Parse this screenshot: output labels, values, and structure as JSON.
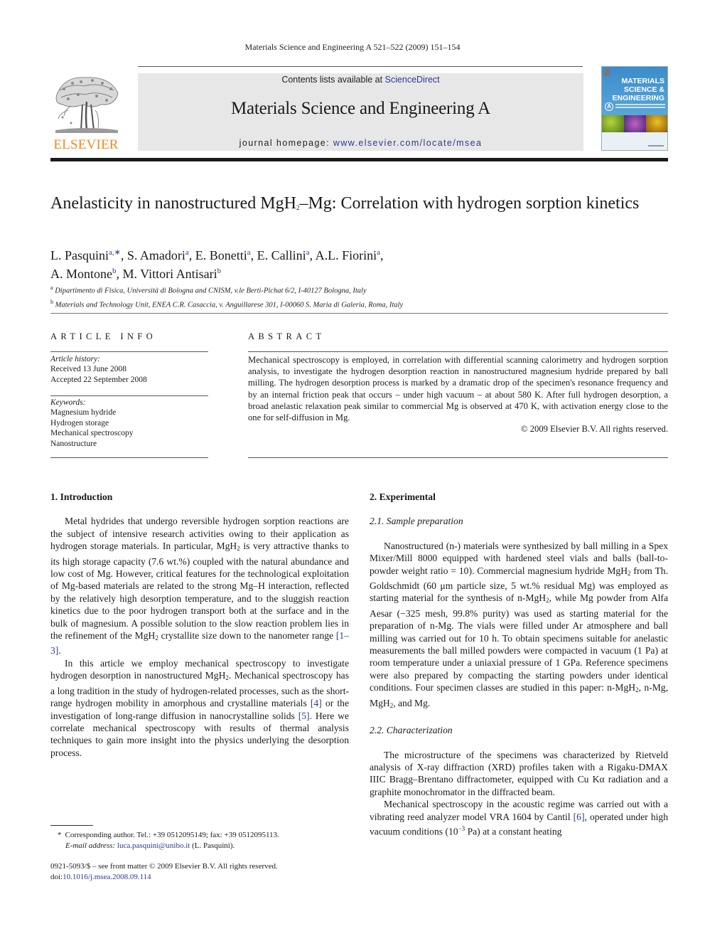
{
  "running_head": "Materials Science and Engineering A 521–522 (2009) 151–154",
  "publisher": {
    "logo_word": "ELSEVIER",
    "logo_icon": "elsevier-tree-icon"
  },
  "banner": {
    "contents_prefix": "Contents lists available at ",
    "contents_link": "ScienceDirect",
    "journal_title": "Materials Science and Engineering A",
    "homepage_prefix": "journal homepage: ",
    "homepage_link": "www.elsevier.com/locate/msea"
  },
  "cover": {
    "title_lines": [
      "MATERIALS",
      "SCIENCE &",
      "ENGINEERING"
    ],
    "series_letter": "A"
  },
  "article": {
    "title_part1": "Anelasticity in nanostructured MgH",
    "title_sub": "2",
    "title_part2": "–Mg: Correlation with hydrogen sorption kinetics",
    "authors": [
      {
        "name": "L. Pasquini",
        "aff": "a,∗"
      },
      {
        "name": "S. Amadori",
        "aff": "a"
      },
      {
        "name": "E. Bonetti",
        "aff": "a"
      },
      {
        "name": "E. Callini",
        "aff": "a"
      },
      {
        "name": "A.L. Fiorini",
        "aff": "a"
      },
      {
        "name": "A. Montone",
        "aff": "b"
      },
      {
        "name": "M. Vittori Antisari",
        "aff": "b"
      }
    ],
    "affiliations": [
      {
        "mark": "a",
        "text": "Dipartimento di Fisica, Università di Bologna and CNISM, v.le Berti-Pichat 6/2, I-40127 Bologna, Italy"
      },
      {
        "mark": "b",
        "text": "Materials and Technology Unit, ENEA C.R. Casaccia, v. Anguillarese 301, I-00060 S. Maria di Galeria, Roma, Italy"
      }
    ]
  },
  "article_info": {
    "heading": "ARTICLE INFO",
    "history_label": "Article history:",
    "received": "Received 13 June 2008",
    "accepted": "Accepted 22 September 2008",
    "keywords_label": "Keywords:",
    "keywords": [
      "Magnesium hydride",
      "Hydrogen storage",
      "Mechanical spectroscopy",
      "Nanostructure"
    ]
  },
  "abstract": {
    "heading": "ABSTRACT",
    "text": "Mechanical spectroscopy is employed, in correlation with differential scanning calorimetry and hydrogen sorption analysis, to investigate the hydrogen desorption reaction in nanostructured magnesium hydride prepared by ball milling. The hydrogen desorption process is marked by a dramatic drop of the specimen's resonance frequency and by an internal friction peak that occurs – under high vacuum – at about 580 K. After full hydrogen desorption, a broad anelastic relaxation peak similar to commercial Mg is observed at 470 K, with activation energy close to the one for self-diffusion in Mg.",
    "copyright": "© 2009 Elsevier B.V. All rights reserved."
  },
  "sections": {
    "intro": {
      "heading": "1.  Introduction",
      "p1": {
        "a": "Metal hydrides that undergo reversible hydrogen sorption reactions are the subject of intensive research activities owing to their application as hydrogen storage materials. In particular, MgH",
        "b": " is very attractive thanks to its high storage capacity (7.6 wt.%) coupled with the natural abundance and low cost of Mg. However, critical features for the technological exploitation of Mg-based materials are related to the strong Mg–H interaction, reflected by the relatively high desorption temperature, and to the sluggish reaction kinetics due to the poor hydrogen transport both at the surface and in the bulk of magnesium. A possible solution to the slow reaction problem lies in the refinement of the MgH",
        "c": " crystallite size down to the nanometer range ",
        "ref": "[1–3]",
        "d": "."
      },
      "p2": {
        "a": "In this article we employ mechanical spectroscopy to investigate hydrogen desorption in nanostructured MgH",
        "b": ". Mechanical spectroscopy has a long tradition in the study of hydrogen-related processes, such as the short-range hydrogen mobility in amorphous and crystalline materials ",
        "ref1": "[4]",
        "c": " or the investigation of long-range diffusion in nanocrystalline solids ",
        "ref2": "[5]",
        "d": ". Here we correlate mechanical spectroscopy with results of thermal analysis techniques to gain more insight into the physics underlying the desorption process."
      }
    },
    "experimental": {
      "heading": "2.  Experimental",
      "sub1": "2.1.  Sample preparation",
      "p1": {
        "a": "Nanostructured (n-) materials were synthesized by ball milling in a Spex Mixer/Mill 8000 equipped with hardened steel vials and balls (ball-to-powder weight ratio = 10). Commercial magnesium hydride MgH",
        "b": " from Th. Goldschmidt (60 μm particle size, 5 wt.% residual Mg) was employed as starting material for the synthesis of n-MgH",
        "c": ", while Mg powder from Alfa Aesar (−325 mesh, 99.8% purity) was used as starting material for the preparation of n-Mg. The vials were filled under Ar atmosphere and ball milling was carried out for 10 h. To obtain specimens suitable for anelastic measurements the ball milled powders were compacted in vacuum (1 Pa) at room temperature under a uniaxial pressure of 1 GPa. Reference specimens were also prepared by compacting the starting powders under identical conditions. Four specimen classes are studied in this paper: n-MgH",
        "d": ", n-Mg, MgH",
        "e": ", and Mg."
      },
      "sub2": "2.2.  Characterization",
      "p2": "The microstructure of the specimens was characterized by Rietveld analysis of X-ray diffraction (XRD) profiles taken with a Rigaku-DMAX IIIC Bragg–Brentano diffractometer, equipped with Cu Kα radiation and a graphite monochromator in the diffracted beam.",
      "p3": {
        "a": "Mechanical spectroscopy in the acoustic regime was carried out with a vibrating reed analyzer model VRA 1604 by Cantil ",
        "ref": "[6]",
        "b": ", operated under high vacuum conditions (10",
        "exp": "−3",
        "c": " Pa) at a constant heating"
      }
    }
  },
  "subscript_two": "2",
  "footnote": {
    "star": "*",
    "corresponding": "Corresponding author. Tel.: +39 0512095149; fax: +39 0512095113.",
    "email_label": "E-mail address:",
    "email": "luca.pasquini@unibo.it",
    "email_suffix": " (L. Pasquini)."
  },
  "frontmatter": {
    "issn_line": "0921-5093/$ – see front matter © 2009 Elsevier B.V. All rights reserved.",
    "doi_prefix": "doi:",
    "doi": "10.1016/j.msea.2008.09.114"
  },
  "colors": {
    "link": "#2a3a8c",
    "elsevier_orange": "#f28a1e",
    "banner_bg": "#e7e7e8"
  }
}
